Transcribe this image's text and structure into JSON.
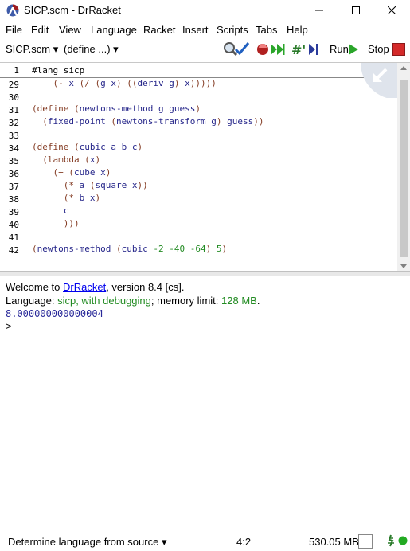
{
  "window": {
    "title": "SICP.scm - DrRacket",
    "controls": [
      "minimize",
      "maximize",
      "close"
    ]
  },
  "menu": [
    "File",
    "Edit",
    "View",
    "Language",
    "Racket",
    "Insert",
    "Scripts",
    "Tabs",
    "Help"
  ],
  "toolbar": {
    "file_menu": "SICP.scm",
    "define_menu": "(define ...)",
    "run_label": "Run",
    "stop_label": "Stop"
  },
  "editor": {
    "sticky_line": {
      "number": "1",
      "text": "#lang sicp"
    },
    "lines": [
      {
        "n": "29",
        "text": "    (- x (/ (g x) ((deriv g) x)))))"
      },
      {
        "n": "30",
        "text": ""
      },
      {
        "n": "31",
        "text": "(define (newtons-method g guess)"
      },
      {
        "n": "32",
        "text": "  (fixed-point (newtons-transform g) guess))"
      },
      {
        "n": "33",
        "text": ""
      },
      {
        "n": "34",
        "text": "(define (cubic a b c)"
      },
      {
        "n": "35",
        "text": "  (lambda (x)"
      },
      {
        "n": "36",
        "text": "    (+ (cube x)"
      },
      {
        "n": "37",
        "text": "      (* a (square x))"
      },
      {
        "n": "38",
        "text": "      (* b x)"
      },
      {
        "n": "39",
        "text": "      c"
      },
      {
        "n": "40",
        "text": "      )))"
      },
      {
        "n": "41",
        "text": ""
      },
      {
        "n": "42",
        "text": "(newtons-method (cubic -2 -40 -64) 5)"
      }
    ]
  },
  "repl": {
    "welcome_prefix": "Welcome to ",
    "welcome_link": "DrRacket",
    "welcome_suffix": ", version 8.4 [cs].",
    "lang_prefix": "Language: ",
    "lang_value": "sicp, with debugging",
    "mem_prefix": "; memory limit: ",
    "mem_value": "128 MB",
    "mem_suffix": ".",
    "result": "8.000000000000004",
    "prompt": ">"
  },
  "status": {
    "language_menu": "Determine language from source",
    "position": "4:2",
    "memory": "530.05 MB"
  },
  "colors": {
    "paren": "#843c24",
    "identifier": "#26268a",
    "number": "#228b22",
    "run_green": "#2aa52a",
    "stop_red": "#d42a2a",
    "link": "#0000ee"
  }
}
